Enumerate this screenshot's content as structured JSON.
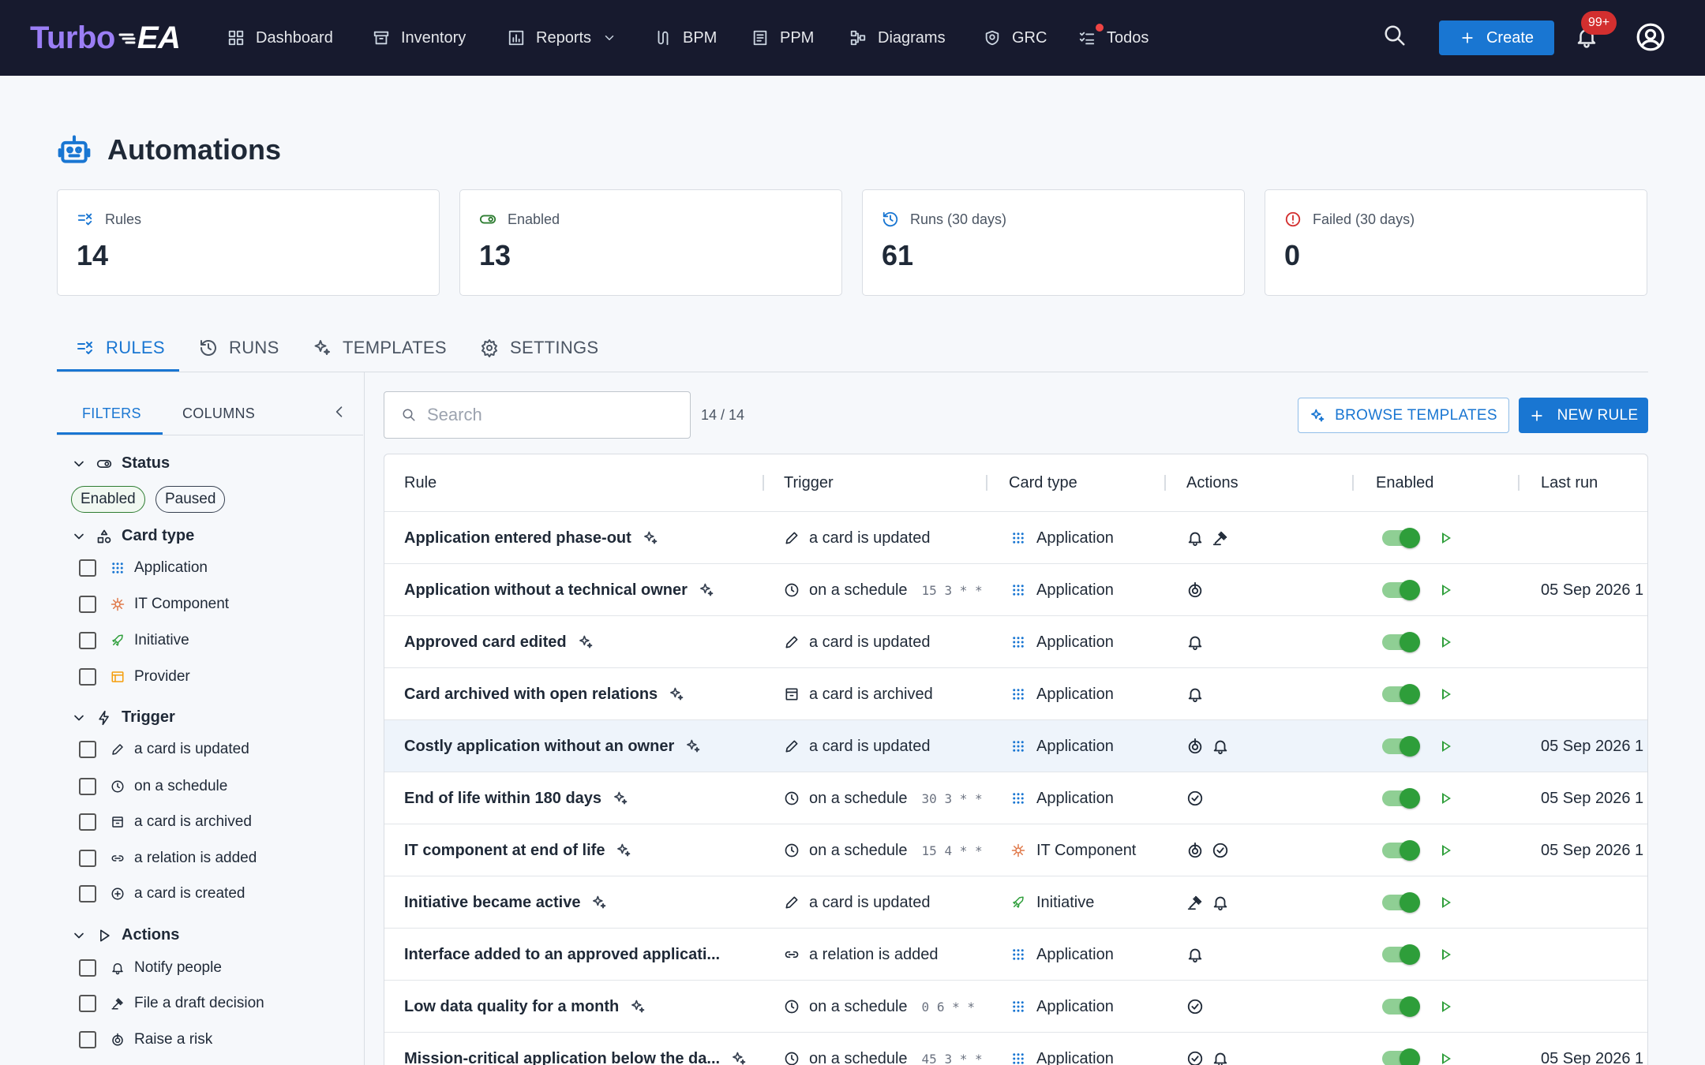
{
  "app": {
    "logo_turbo": "Turbo",
    "logo_ea": "EA",
    "nav": [
      "Dashboard",
      "Inventory",
      "Reports",
      "BPM",
      "PPM",
      "Diagrams",
      "GRC",
      "Todos"
    ],
    "create_label": "Create",
    "notif_badge": "99+"
  },
  "page": {
    "title": "Automations"
  },
  "stats": [
    {
      "label": "Rules",
      "value": "14",
      "icon": "rule-icon",
      "color": "#1976d2"
    },
    {
      "label": "Enabled",
      "value": "13",
      "icon": "toggle-icon",
      "color": "#2e7d32"
    },
    {
      "label": "Runs (30 days)",
      "value": "61",
      "icon": "history-icon",
      "color": "#1976d2"
    },
    {
      "label": "Failed (30 days)",
      "value": "0",
      "icon": "error-icon",
      "color": "#d32f2f"
    }
  ],
  "tabs": [
    "RULES",
    "RUNS",
    "TEMPLATES",
    "SETTINGS"
  ],
  "sidebar": {
    "tabs": [
      "FILTERS",
      "COLUMNS"
    ],
    "status": {
      "title": "Status",
      "chips": [
        "Enabled",
        "Paused"
      ]
    },
    "card_type": {
      "title": "Card type",
      "options": [
        "Application",
        "IT Component",
        "Initiative",
        "Provider"
      ]
    },
    "trigger": {
      "title": "Trigger",
      "options": [
        "a card is updated",
        "on a schedule",
        "a card is archived",
        "a relation is added",
        "a card is created"
      ]
    },
    "actions": {
      "title": "Actions",
      "options": [
        "Notify people",
        "File a draft decision",
        "Raise a risk"
      ]
    }
  },
  "toolbar": {
    "search_placeholder": "Search",
    "count": "14 / 14",
    "browse_label": "BROWSE TEMPLATES",
    "new_rule_label": "NEW RULE"
  },
  "table": {
    "columns": [
      "Rule",
      "Trigger",
      "Card type",
      "Actions",
      "Enabled",
      "Last run"
    ],
    "rows": [
      {
        "rule": "Application entered phase-out",
        "trigger": "a card is updated",
        "trigger_icon": "pencil",
        "cron": "",
        "card_type": "Application",
        "actions": [
          "bell-icon",
          "gavel-icon"
        ],
        "last_run": ""
      },
      {
        "rule": "Application without a technical owner",
        "trigger": "on a schedule",
        "trigger_icon": "clock",
        "cron": "15 3 * *",
        "card_type": "Application",
        "actions": [
          "risk-icon"
        ],
        "last_run": "05 Sep 2026 1"
      },
      {
        "rule": "Approved card edited",
        "trigger": "a card is updated",
        "trigger_icon": "pencil",
        "cron": "",
        "card_type": "Application",
        "actions": [
          "bell-icon"
        ],
        "last_run": ""
      },
      {
        "rule": "Card archived with open relations",
        "trigger": "a card is archived",
        "trigger_icon": "archive",
        "cron": "",
        "card_type": "Application",
        "actions": [
          "bell-icon"
        ],
        "last_run": ""
      },
      {
        "rule": "Costly application without an owner",
        "trigger": "a card is updated",
        "trigger_icon": "pencil",
        "cron": "",
        "card_type": "Application",
        "actions": [
          "risk-icon",
          "bell-icon"
        ],
        "last_run": "05 Sep 2026 1"
      },
      {
        "rule": "End of life within 180 days",
        "trigger": "on a schedule",
        "trigger_icon": "clock",
        "cron": "30 3 * *",
        "card_type": "Application",
        "actions": [
          "check-icon"
        ],
        "last_run": "05 Sep 2026 1"
      },
      {
        "rule": "IT component at end of life",
        "trigger": "on a schedule",
        "trigger_icon": "clock",
        "cron": "15 4 * *",
        "card_type": "IT Component",
        "actions": [
          "risk-icon",
          "check-icon"
        ],
        "last_run": "05 Sep 2026 1"
      },
      {
        "rule": "Initiative became active",
        "trigger": "a card is updated",
        "trigger_icon": "pencil",
        "cron": "",
        "card_type": "Initiative",
        "actions": [
          "gavel-icon",
          "bell-icon"
        ],
        "last_run": ""
      },
      {
        "rule": "Interface added to an approved applicati...",
        "trigger": "a relation is added",
        "trigger_icon": "link",
        "cron": "",
        "card_type": "Application",
        "actions": [
          "bell-icon"
        ],
        "last_run": ""
      },
      {
        "rule": "Low data quality for a month",
        "trigger": "on a schedule",
        "trigger_icon": "clock",
        "cron": "0 6 * *",
        "card_type": "Application",
        "actions": [
          "check-icon"
        ],
        "last_run": ""
      },
      {
        "rule": "Mission-critical application below the da...",
        "trigger": "on a schedule",
        "trigger_icon": "clock",
        "cron": "45 3 * *",
        "card_type": "Application",
        "actions": [
          "check-icon",
          "bell-icon"
        ],
        "last_run": "05 Sep 2026 1"
      }
    ]
  }
}
